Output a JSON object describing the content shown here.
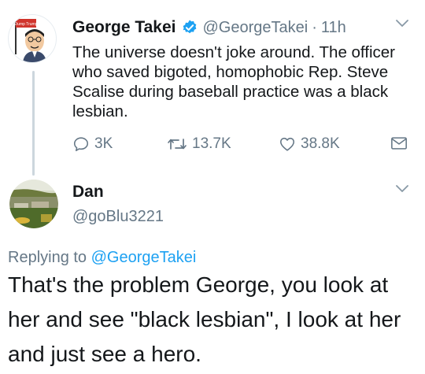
{
  "tweet": {
    "author_name": "George Takei",
    "author_handle": "@GeorgeTakei",
    "separator": "·",
    "time": "11h",
    "verified": true,
    "avatar_sign_text": "Dump Trump",
    "text": "The universe doesn't joke around. The officer who saved bigoted, homophobic Rep. Steve Scalise during baseball practice was a black lesbian.",
    "replies": "3K",
    "retweets": "13.7K",
    "likes": "38.8K"
  },
  "reply": {
    "author_name": "Dan",
    "author_handle": "@goBlu3221",
    "replying_prefix": "Replying to",
    "replying_to": "@GeorgeTakei",
    "text": "That's the problem George, you look at her and see \"black lesbian\", I look at her and just see a hero."
  },
  "colors": {
    "primary_text": "#14171a",
    "secondary_text": "#657786",
    "accent": "#1da1f2",
    "thread_line": "#ccd6dd",
    "avatar_sign_red": "#d0342c"
  },
  "icons": {
    "reply": "reply-icon",
    "retweet": "retweet-icon",
    "like": "heart-icon",
    "message": "envelope-icon",
    "more": "chevron-down-icon",
    "verified": "verified-badge-icon"
  }
}
